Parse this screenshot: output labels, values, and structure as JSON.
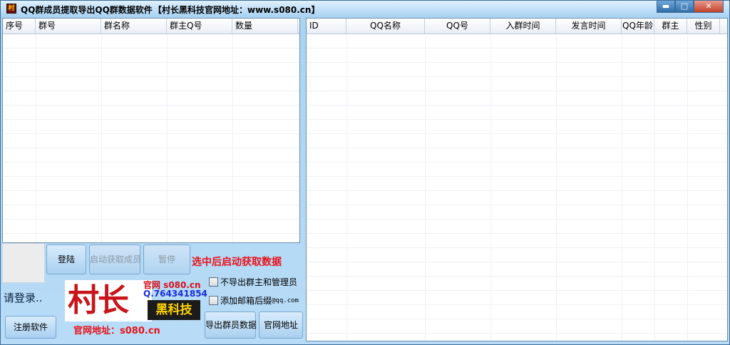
{
  "window": {
    "title": "QQ群成员提取导出QQ群数据软件",
    "title_extra": "【村长黑科技官网地址：www.s080.cn】",
    "icon": "app-icon",
    "minimize": "▬",
    "maximize": "□",
    "close": "✕"
  },
  "left_table": {
    "columns": [
      "序号",
      "群号",
      "群名称",
      "群主Q号",
      "数量"
    ]
  },
  "right_table": {
    "columns": [
      "ID",
      "QQ名称",
      "QQ号",
      "入群时间",
      "发言时间",
      "QQ年龄",
      "群主",
      "性别"
    ]
  },
  "buttons": {
    "login": "登陆",
    "start": "启动获取成员",
    "pause": "暂停",
    "register": "注册软件",
    "export": "导出群员数据",
    "site": "官网地址"
  },
  "hint": "选中后启动获取数据",
  "login_status": "请登录..",
  "options": {
    "exclude_admin": {
      "label": "不导出群主和管理员",
      "checked": false
    },
    "add_mail": {
      "label": "添加邮箱后缀",
      "suffix": "@qq.com",
      "checked": false
    }
  },
  "logo": {
    "big": "村长",
    "site": "官网 s080.cn",
    "qq": "Q.764341854",
    "tag": "黑科技",
    "address": "官网地址：s080.cn"
  },
  "colors": {
    "accent": "#a9d3f3",
    "hint_red": "#e8121a",
    "logo_yellow": "#ffd400"
  }
}
